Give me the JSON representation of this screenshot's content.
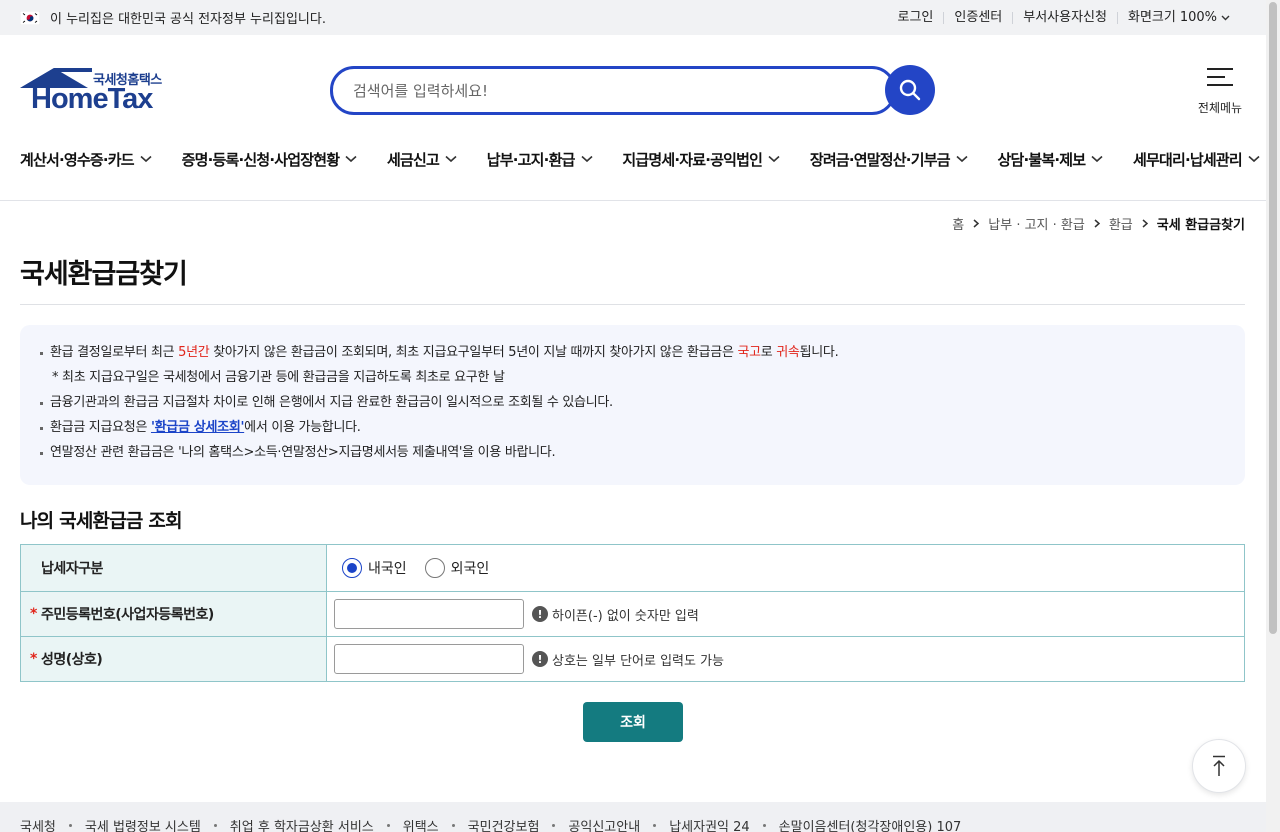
{
  "gov_bar": {
    "notice": "이 누리집은 대한민국 공식 전자정부 누리집입니다.",
    "utils": [
      "로그인",
      "인증센터",
      "부서사용자신청"
    ],
    "zoom_label": "화면크기",
    "zoom_value": "100%"
  },
  "header": {
    "logo_sub": "국세청홈택스",
    "logo_main": "HomeTax",
    "search_placeholder": "검색어를 입력하세요!",
    "search_value": "",
    "allmenu_label": "전체메뉴"
  },
  "gnb": [
    "계산서·영수증·카드",
    "증명·등록·신청·사업장현황",
    "세금신고",
    "납부·고지·환급",
    "지급명세·자료·공익법인",
    "장려금·연말정산·기부금",
    "상담·불복·제보",
    "세무대리·납세관리"
  ],
  "breadcrumb": [
    "홈",
    "납부 · 고지 · 환급",
    "환급",
    "국세 환급금찾기"
  ],
  "page_title": "국세환급금찾기",
  "notice": {
    "l1_a": "환급 결정일로부터 최근 ",
    "l1_red": "5년간",
    "l1_b": " 찾아가지 않은 환급금이 조회되며, 최초 지급요구일부터 5년이 지날 때까지 찾아가지 않은 환급금은 ",
    "l1_red2": "국고",
    "l1_c": "로 ",
    "l1_red3": "귀속",
    "l1_d": "됩니다.",
    "l2": "* 최초 지급요구일은 국세청에서 금융기관 등에 환급금을 지급하도록 최초로 요구한 날",
    "l3": "금융기관과의 환급금 지급절차 차이로 인해 은행에서 지급 완료한 환급금이 일시적으로 조회될 수 있습니다.",
    "l4_a": "환급금 지급요청은 ",
    "l4_link": "'환급금 상세조회'",
    "l4_b": "에서 이용 가능합니다.",
    "l5": "연말정산 관련 환급금은 '나의 홈택스>소득·연말정산>지급명세서등 제출내역'을 이용 바랍니다."
  },
  "form": {
    "title": "나의 국세환급금 조회",
    "row1_label": "납세자구분",
    "radio_domestic": "내국인",
    "radio_foreign": "외국인",
    "selected": "domestic",
    "row2_label": "주민등록번호(사업자등록번호)",
    "row2_hint": "하이픈(-) 없이 숫자만 입력",
    "row2_value": "",
    "row3_label": "성명(상호)",
    "row3_hint": "상호는 일부 단어로 입력도 가능",
    "row3_value": "",
    "required_mark": "*",
    "hint_icon": "!",
    "submit": "조회"
  },
  "footer_links": [
    "국세청",
    "국세 법령정보 시스템",
    "취업 후 학자금상환 서비스",
    "위택스",
    "국민건강보험",
    "공익신고안내",
    "납세자권익 24",
    "손말이음센터(청각장애인용) 107"
  ],
  "colors": {
    "primary_blue": "#2345c6",
    "teal": "#147b80",
    "red": "#e1251b"
  }
}
